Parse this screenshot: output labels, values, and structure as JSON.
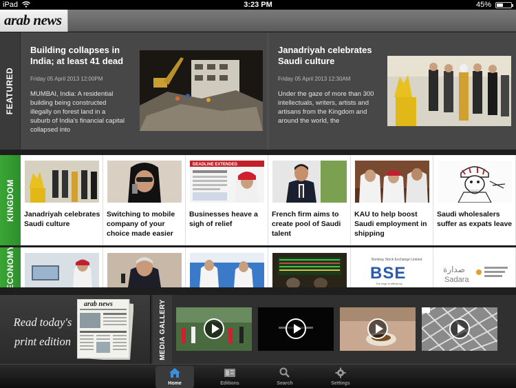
{
  "status_bar": {
    "device": "iPad",
    "time": "3:23 PM",
    "battery": "45%",
    "battery_level": 0.45
  },
  "header": {
    "logo_text": "arab news"
  },
  "featured": {
    "label": "FEATURED",
    "articles": [
      {
        "title": "Building collapses in India; at least 41 dead",
        "date": "Friday 05 April 2013 12:00PM",
        "summary": "MUMBAI, India: A residential building being constructed illegally on forest land in a suburb of India's financial capital collapsed into"
      },
      {
        "title": "Janadriyah celebrates Saudi culture",
        "date": "Friday 05 April 2013 12:30AM",
        "summary": "Under the gaze of more than 300 intellectuals, writers, artists and artisans from the Kingdom and around the world, the"
      }
    ]
  },
  "kingdom": {
    "label": "KINGDOM",
    "items": [
      {
        "caption": "Janadriyah celebrates Saudi culture"
      },
      {
        "caption": "Switching to mobile company of your choice made easier"
      },
      {
        "caption": "Businesses heave a sigh of relief"
      },
      {
        "caption": "French firm aims to create pool of Saudi talent"
      },
      {
        "caption": "KAU to help boost Saudi employment in shipping"
      },
      {
        "caption": "Saudi wholesalers suffer as expats leave"
      }
    ],
    "thumb_text": {
      "deadline": "DEADLINE EXTENDED"
    }
  },
  "economy": {
    "label": "ECONOMY",
    "thumb_text": {
      "bse_name": "Bombay Stock Exchange Limited",
      "bse_logo": "BSE",
      "bse_tagline": "The edge is efficiency",
      "sadara_ar": "صدارة",
      "sadara_en": "Sadara"
    }
  },
  "print_edition": {
    "text_line1": "Read today's",
    "text_line2": "print edition"
  },
  "media_gallery": {
    "label": "MEDIA GALLERY",
    "videos": 4
  },
  "tabbar": {
    "tabs": [
      {
        "label": "Home",
        "active": true
      },
      {
        "label": "Editions",
        "active": false
      },
      {
        "label": "Search",
        "active": false
      },
      {
        "label": "Settings",
        "active": false
      }
    ]
  }
}
